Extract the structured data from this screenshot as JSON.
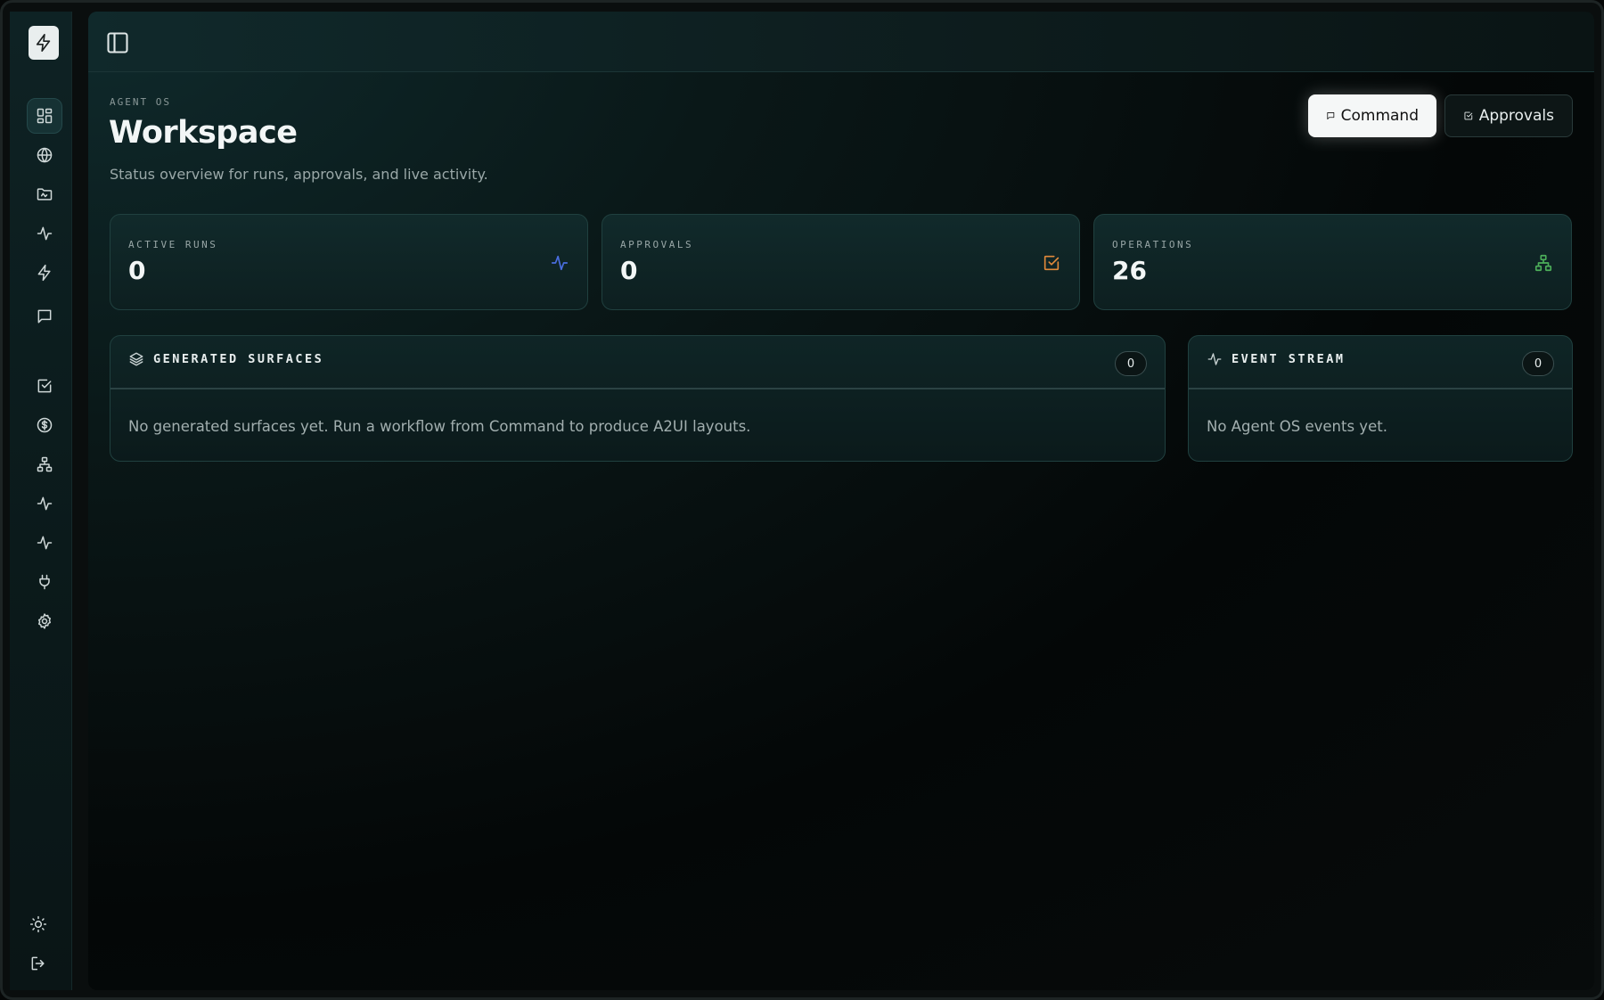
{
  "sidebar": {
    "logo": "bolt-icon",
    "items": [
      {
        "icon": "dashboard-icon",
        "name": "dashboard",
        "active": true
      },
      {
        "icon": "globe-icon",
        "name": "globe"
      },
      {
        "icon": "folder-icon",
        "name": "folder"
      },
      {
        "icon": "activity-icon",
        "name": "activity"
      },
      {
        "icon": "bolt-icon",
        "name": "bolt"
      },
      {
        "icon": "message-icon",
        "name": "messages"
      },
      {
        "icon": "check-square-icon",
        "name": "approvals"
      },
      {
        "icon": "dollar-icon",
        "name": "billing"
      },
      {
        "icon": "network-icon",
        "name": "operations"
      },
      {
        "icon": "activity-icon",
        "name": "activity-2"
      },
      {
        "icon": "activity-icon",
        "name": "activity-3"
      },
      {
        "icon": "plug-icon",
        "name": "integrations"
      },
      {
        "icon": "gear-icon",
        "name": "settings"
      }
    ],
    "bottom": [
      {
        "icon": "sun-icon",
        "name": "theme"
      },
      {
        "icon": "logout-icon",
        "name": "logout"
      }
    ]
  },
  "header": {
    "eyebrow": "AGENT OS",
    "title": "Workspace",
    "subtitle": "Status overview for runs, approvals, and live activity.",
    "command_label": "Command",
    "approvals_label": "Approvals"
  },
  "stats": [
    {
      "label": "ACTIVE RUNS",
      "value": "0",
      "icon": "activity-icon",
      "color": "#4a6ee0"
    },
    {
      "label": "APPROVALS",
      "value": "0",
      "icon": "check-square-icon",
      "color": "#e0893a"
    },
    {
      "label": "OPERATIONS",
      "value": "26",
      "icon": "network-icon",
      "color": "#4caf5a"
    }
  ],
  "panels": {
    "surfaces": {
      "title": "GENERATED SURFACES",
      "count": "0",
      "empty": "No generated surfaces yet. Run a workflow from Command to produce A2UI layouts."
    },
    "events": {
      "title": "EVENT STREAM",
      "count": "0",
      "empty": "No Agent OS events yet."
    }
  }
}
